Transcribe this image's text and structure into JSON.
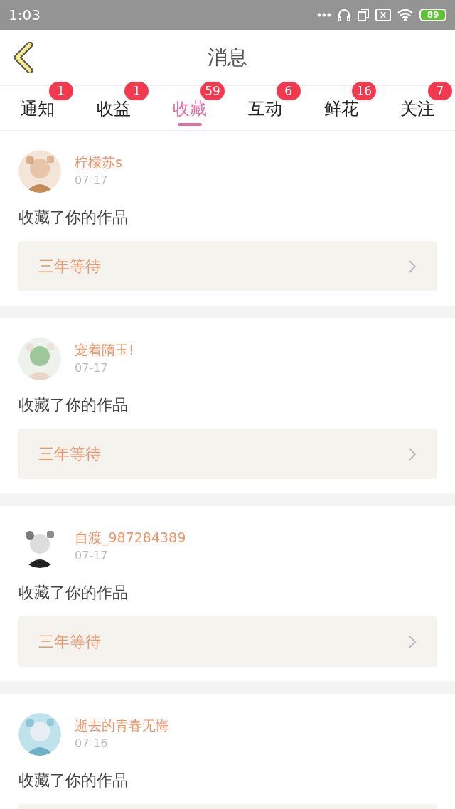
{
  "status_bar": {
    "time": "1:03",
    "battery": "89"
  },
  "header": {
    "title": "消息"
  },
  "tabs": [
    {
      "label": "通知",
      "badge": "1",
      "selected": false
    },
    {
      "label": "收益",
      "badge": "1",
      "selected": false
    },
    {
      "label": "收藏",
      "badge": "59",
      "selected": true
    },
    {
      "label": "互动",
      "badge": "6",
      "selected": false
    },
    {
      "label": "鲜花",
      "badge": "16",
      "selected": false
    },
    {
      "label": "关注",
      "badge": "7",
      "selected": false
    }
  ],
  "messages": [
    {
      "user": "柠檬苏s",
      "date": "07-17",
      "action": "收藏了你的作品",
      "work": "三年等待"
    },
    {
      "user": "宠着隋玉!",
      "date": "07-17",
      "action": "收藏了你的作品",
      "work": "三年等待"
    },
    {
      "user": "自渡_987284389",
      "date": "07-17",
      "action": "收藏了你的作品",
      "work": "三年等待"
    },
    {
      "user": "逝去的青春无悔",
      "date": "07-16",
      "action": "收藏了你的作品"
    }
  ]
}
